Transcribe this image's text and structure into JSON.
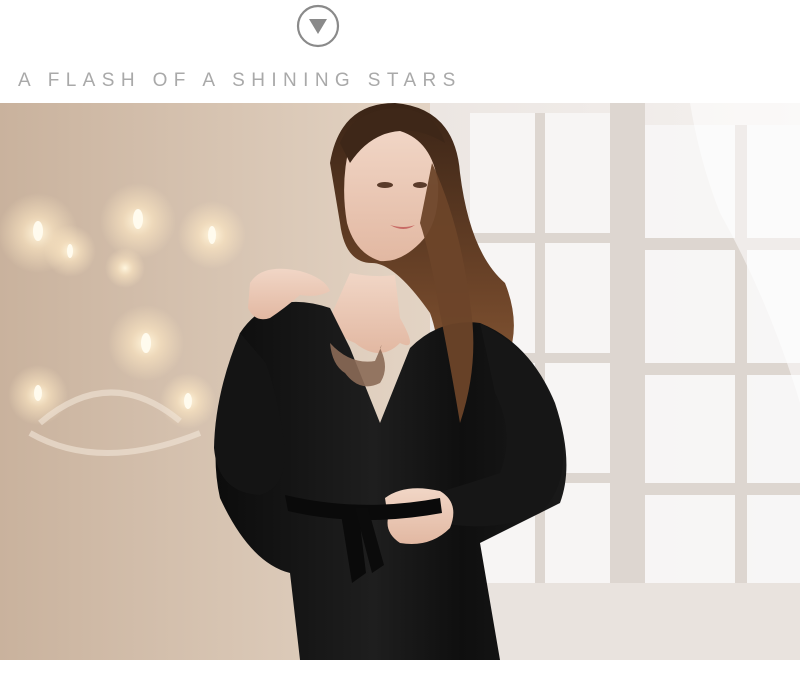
{
  "header": {
    "scroll_icon": "down-arrow-circle-icon",
    "tagline": "A FLASH OF A SHINING STARS"
  },
  "colors": {
    "tagline": "#a9a9a9",
    "icon": "#8a8a8a",
    "background": "#ffffff",
    "robe": "#121212"
  },
  "photo": {
    "subject": "model-in-black-satin-robe"
  }
}
